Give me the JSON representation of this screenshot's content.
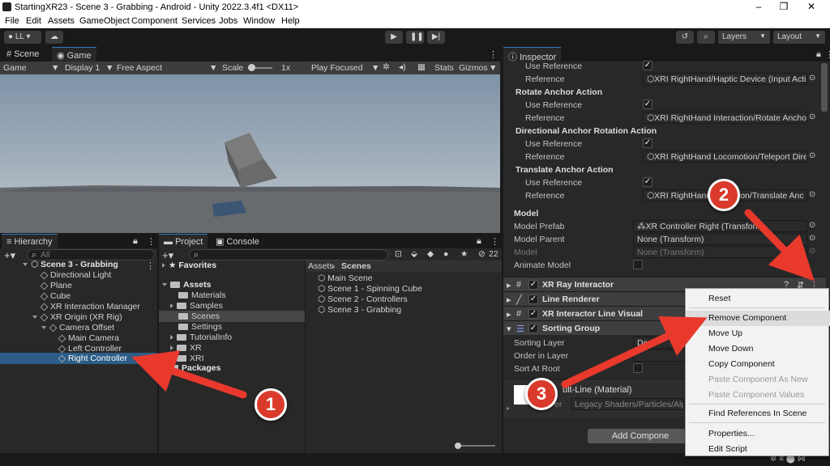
{
  "window": {
    "title": "StartingXR23 - Scene 3 - Grabbing - Android - Unity 2022.3.4f1 <DX11>",
    "controls": [
      "–",
      "❐",
      "✕"
    ]
  },
  "menubar": [
    "File",
    "Edit",
    "Assets",
    "GameObject",
    "Component",
    "Services",
    "Jobs",
    "Window",
    "Help"
  ],
  "toolbar": {
    "account": "LL",
    "layers": "Layers",
    "layout": "Layout"
  },
  "scene_game": {
    "tabs": [
      "Scene",
      "Game"
    ],
    "game_dropdown": "Game",
    "display": "Display 1",
    "aspect": "Free Aspect",
    "scale_label": "Scale",
    "scale_value": "1x",
    "play_mode": "Play Focused",
    "stats": "Stats",
    "gizmos": "Gizmos"
  },
  "hierarchy": {
    "tab": "Hierarchy",
    "search_placeholder": "All",
    "scene": "Scene 3 - Grabbing",
    "items": [
      "Directional Light",
      "Plane",
      "Cube",
      "XR Interaction Manager",
      "XR Origin (XR Rig)",
      "Camera Offset",
      "Main Camera",
      "Left Controller",
      "Right Controller"
    ]
  },
  "project": {
    "tabs": [
      "Project",
      "Console"
    ],
    "badge_count": "22",
    "favorites": "Favorites",
    "assets": "Assets",
    "asset_folders": [
      "Materials",
      "Samples",
      "Scenes",
      "Settings",
      "TutorialInfo",
      "XR",
      "XRI"
    ],
    "packages": "Packages",
    "breadcrumb": [
      "Assets",
      "Scenes"
    ],
    "scenes": [
      "Main Scene",
      "Scene 1 - Spinning Cube",
      "Scene 2 - Controllers",
      "Scene 3 - Grabbing"
    ]
  },
  "inspector": {
    "tab": "Inspector",
    "rows": {
      "use_reference_1": "Use Reference",
      "reference_1": "Reference",
      "reference_1_value": "XRI RightHand/Haptic Device (Input Acti",
      "rotate_anchor": "Rotate Anchor Action",
      "use_reference_2": "Use Reference",
      "reference_2": "Reference",
      "reference_2_value": "XRI RightHand Interaction/Rotate Anchor",
      "directional_anchor": "Directional Anchor Rotation Action",
      "use_reference_3": "Use Reference",
      "reference_3": "Reference",
      "reference_3_value": "XRI RightHand Locomotion/Teleport Dire",
      "translate_anchor": "Translate Anchor Action",
      "use_reference_4": "Use Reference",
      "reference_4": "Reference",
      "reference_4_value": "XRI RightHand",
      "reference_4_value_tail": "on/Translate Anc",
      "model": "Model",
      "model_prefab": "Model Prefab",
      "model_prefab_value": "XR Controller Right (Transform",
      "model_parent": "Model Parent",
      "model_parent_value": "None (Transform)",
      "model_label": "Model",
      "model_value": "None (Transform)",
      "animate_model": "Animate Model",
      "sorting_layer": "Sorting Layer",
      "sorting_layer_value": "De",
      "order_in_layer": "Order in Layer",
      "sort_at_root": "Sort At Root",
      "material_name": "ult-Line (Material)",
      "shader_label": "er",
      "shader_value": "Legacy Shaders/Particles/Alp",
      "add_component": "Add Compone"
    },
    "components": [
      "XR Ray Interactor",
      "Line Renderer",
      "XR Interactor Line Visual",
      "Sorting Group"
    ]
  },
  "context_menu": {
    "items": [
      {
        "label": "Reset",
        "disabled": false
      },
      {
        "label": "Remove Component",
        "disabled": false
      },
      {
        "label": "Move Up",
        "disabled": false
      },
      {
        "label": "Move Down",
        "disabled": false
      },
      {
        "label": "Copy Component",
        "disabled": false
      },
      {
        "label": "Paste Component As New",
        "disabled": true
      },
      {
        "label": "Paste Component Values",
        "disabled": true
      },
      {
        "label": "Find References In Scene",
        "disabled": false
      },
      {
        "label": "Properties...",
        "disabled": false
      },
      {
        "label": "Edit Script",
        "disabled": false
      }
    ]
  },
  "annotations": [
    "1",
    "2",
    "3"
  ],
  "colors": {
    "accent": "#d93a2b",
    "selection": "#2c5d87",
    "panel": "#282828"
  }
}
